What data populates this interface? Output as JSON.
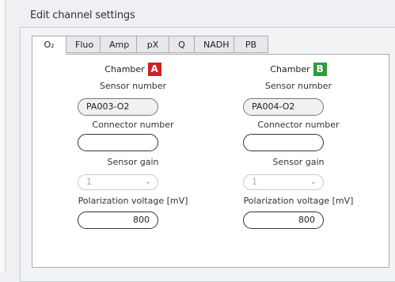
{
  "group": {
    "title": "Edit channel settings"
  },
  "tabs": [
    {
      "label": "O₂",
      "active": true
    },
    {
      "label": "Fluo"
    },
    {
      "label": "Amp"
    },
    {
      "label": "pX"
    },
    {
      "label": "Q"
    },
    {
      "label": "NADH"
    },
    {
      "label": "PB"
    }
  ],
  "chamber_a": {
    "chamber_label": "Chamber",
    "badge": "A",
    "badge_color": "#d11f26",
    "sensor_number_label": "Sensor number",
    "sensor_number_value": "PA003-O2",
    "connector_number_label": "Connector number",
    "connector_number_value": "",
    "sensor_gain_label": "Sensor gain",
    "sensor_gain_value": "1",
    "polarization_label": "Polarization voltage [mV]",
    "polarization_value": "800"
  },
  "chamber_b": {
    "chamber_label": "Chamber",
    "badge": "B",
    "badge_color": "#2f9a3c",
    "sensor_number_label": "Sensor number",
    "sensor_number_value": "PA004-O2",
    "connector_number_label": "Connector number",
    "connector_number_value": "",
    "sensor_gain_label": "Sensor gain",
    "sensor_gain_value": "1",
    "polarization_label": "Polarization voltage [mV]",
    "polarization_value": "800"
  }
}
